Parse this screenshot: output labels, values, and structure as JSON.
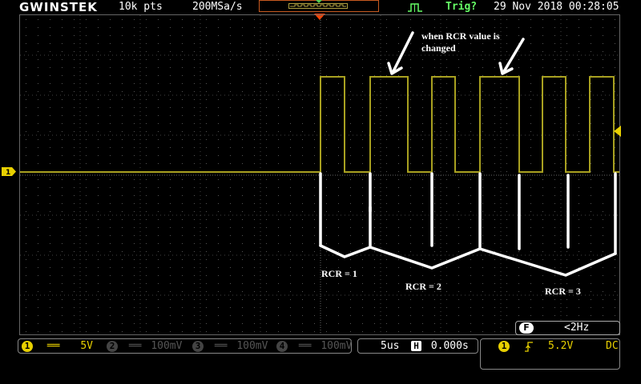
{
  "header": {
    "brand": "GWINSTEK",
    "record_length": "10k pts",
    "sample_rate": "200MSa/s",
    "trigger_status": "Trig?",
    "datetime": "29 Nov 2018 00:28:05"
  },
  "channels": [
    {
      "num": "1",
      "coupling": "══",
      "scale": "5V",
      "active": true
    },
    {
      "num": "2",
      "coupling": "══",
      "scale": "100mV",
      "active": false
    },
    {
      "num": "3",
      "coupling": "══",
      "scale": "100mV",
      "active": false
    },
    {
      "num": "4",
      "coupling": "══",
      "scale": "100mV",
      "active": false
    }
  ],
  "timebase": {
    "scale": "5us",
    "position_label": "H",
    "position": "0.000s"
  },
  "trigger": {
    "source": "1",
    "slope_icon": "rising-edge-icon",
    "level": "5.2V",
    "coupling": "DC"
  },
  "frequency": {
    "badge": "F",
    "value": "<2Hz"
  },
  "annotations": {
    "note_line1": "when RCR value is",
    "note_line2": "changed",
    "rcr1": "RCR = 1",
    "rcr2": "RCR = 2",
    "rcr3": "RCR = 3"
  },
  "colors": {
    "trace": "#a8a020",
    "channel1": "#e8d000",
    "trigger_marker": "#ff4400",
    "grid": "#555555"
  }
}
